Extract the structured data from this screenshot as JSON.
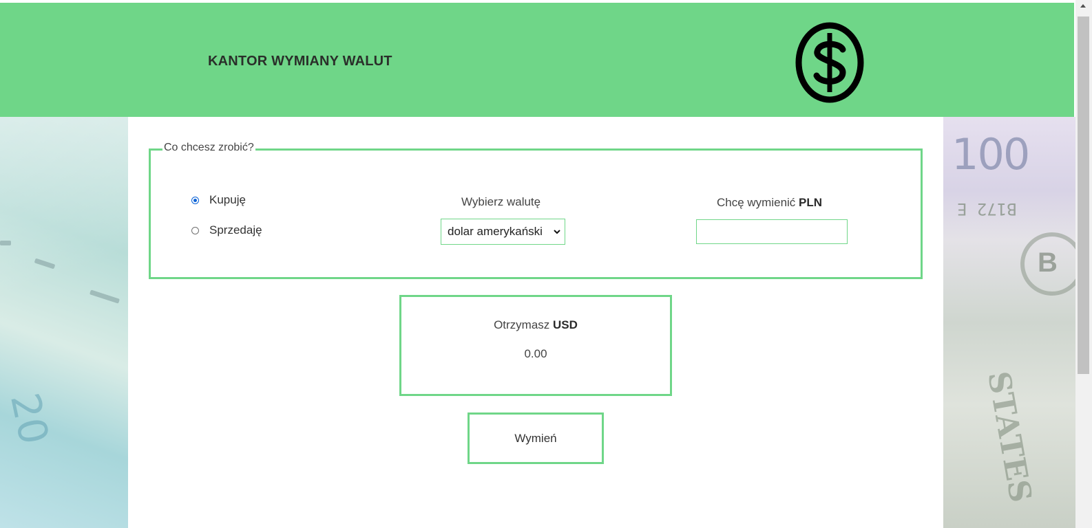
{
  "header": {
    "title": "KANTOR WYMIANY WALUT",
    "logo_icon": "dollar-circle-icon"
  },
  "form": {
    "legend": "Co chcesz zrobić?",
    "operation": {
      "options": [
        {
          "label": "Kupuję",
          "checked": true
        },
        {
          "label": "Sprzedaję",
          "checked": false
        }
      ]
    },
    "currency": {
      "label": "Wybierz walutę",
      "selected": "dolar amerykański"
    },
    "amount": {
      "label_prefix": "Chcę wymienić",
      "label_currency": "PLN",
      "value": ""
    }
  },
  "result": {
    "label_prefix": "Otrzymasz",
    "label_currency": "USD",
    "value": "0.00"
  },
  "actions": {
    "exchange_label": "Wymień"
  },
  "colors": {
    "accent": "#6fd688",
    "radio_selected": "#0b62d6"
  }
}
